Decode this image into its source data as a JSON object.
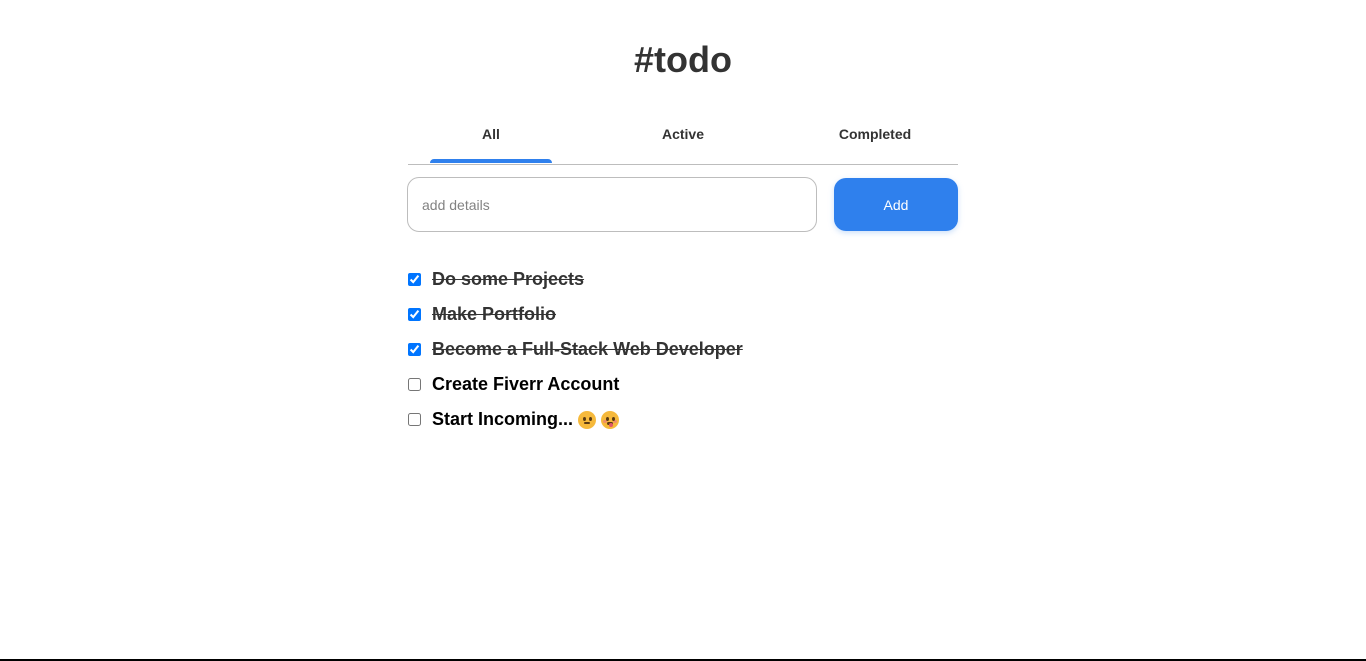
{
  "header": {
    "title": "#todo"
  },
  "tabs": [
    {
      "label": "All",
      "selected": true
    },
    {
      "label": "Active",
      "selected": false
    },
    {
      "label": "Completed",
      "selected": false
    }
  ],
  "input": {
    "placeholder": "add details",
    "value": ""
  },
  "add_button": {
    "label": "Add"
  },
  "todos": [
    {
      "text": "Do some Projects",
      "completed": true
    },
    {
      "text": "Make Portfolio",
      "completed": true
    },
    {
      "text": "Become a Full-Stack Web Developer",
      "completed": true
    },
    {
      "text": "Create Fiverr Account",
      "completed": false
    },
    {
      "text": "Start Incoming...",
      "completed": false,
      "emojis": [
        "smiling-face-icon",
        "face-with-tongue-icon"
      ]
    }
  ],
  "colors": {
    "accent": "#2f80ed",
    "text": "#333333",
    "border": "#bdbdbd",
    "checkbox": "#0075ff"
  }
}
